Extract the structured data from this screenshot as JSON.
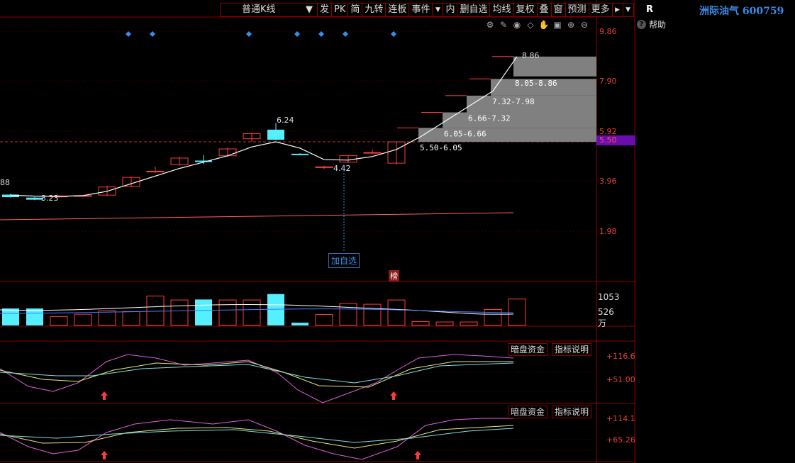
{
  "toolbar": {
    "kline_type": "普通K线",
    "items": [
      "发",
      "PK",
      "简",
      "九转",
      "连板",
      "事件",
      "内",
      "删自选",
      "均线",
      "复权",
      "叠",
      "窗",
      "预测",
      "更多"
    ]
  },
  "right_panel": {
    "label": "R",
    "stock_name": "洲际油气 600759",
    "help": "帮助"
  },
  "price_axis": {
    "ticks": [
      "9.86",
      "7.90",
      "5.92",
      "3.96",
      "1.98"
    ],
    "current": "5.50"
  },
  "volume_axis": {
    "ticks": [
      "1053",
      "526"
    ],
    "unit": "万"
  },
  "ind1": {
    "ticks": [
      "+116.6",
      "+51.00"
    ],
    "btn1": "暗盘资金",
    "btn2": "指标说明"
  },
  "ind2": {
    "ticks": [
      "+114.1",
      "+65.26"
    ],
    "btn1": "暗盘资金",
    "btn2": "指标说明"
  },
  "add_watch": "加自选",
  "bang": "榜",
  "chart_data": {
    "type": "candlestick",
    "ylim": [
      0.8,
      10.6
    ],
    "candles": [
      {
        "o": 3.42,
        "h": 3.46,
        "l": 3.3,
        "c": 3.32,
        "up": false
      },
      {
        "o": 3.3,
        "h": 3.32,
        "l": 3.2,
        "c": 3.22,
        "up": false
      },
      {
        "o": 3.33,
        "h": 3.4,
        "l": 3.3,
        "c": 3.36,
        "up": true
      },
      {
        "o": 3.36,
        "h": 3.4,
        "l": 3.34,
        "c": 3.38,
        "up": true
      },
      {
        "o": 3.4,
        "h": 3.78,
        "l": 3.36,
        "c": 3.72,
        "up": true
      },
      {
        "o": 3.75,
        "h": 4.12,
        "l": 3.72,
        "c": 4.1,
        "up": true
      },
      {
        "o": 4.32,
        "h": 4.52,
        "l": 4.28,
        "c": 4.34,
        "up": true
      },
      {
        "o": 4.6,
        "h": 4.92,
        "l": 4.56,
        "c": 4.86,
        "up": true
      },
      {
        "o": 4.72,
        "h": 4.98,
        "l": 4.62,
        "c": 4.76,
        "up": false
      },
      {
        "o": 4.95,
        "h": 5.28,
        "l": 4.9,
        "c": 5.22,
        "up": true
      },
      {
        "o": 5.62,
        "h": 5.85,
        "l": 5.5,
        "c": 5.82,
        "up": true
      },
      {
        "o": 5.58,
        "h": 6.24,
        "l": 5.56,
        "c": 5.98,
        "up": false
      },
      {
        "o": 5.02,
        "h": 5.05,
        "l": 5.0,
        "c": 5.03,
        "up": false
      },
      {
        "o": 4.52,
        "h": 4.56,
        "l": 4.42,
        "c": 4.48,
        "up": true
      },
      {
        "o": 4.7,
        "h": 4.98,
        "l": 4.66,
        "c": 4.96,
        "up": true
      },
      {
        "o": 5.06,
        "h": 5.2,
        "l": 5.0,
        "c": 5.08,
        "up": true
      },
      {
        "o": 4.66,
        "h": 5.5,
        "l": 4.6,
        "c": 5.5,
        "up": true
      }
    ],
    "ma": [
      3.4,
      3.36,
      3.35,
      3.38,
      3.55,
      3.85,
      4.15,
      4.45,
      4.7,
      4.95,
      5.3,
      5.5,
      5.25,
      4.8,
      4.78,
      4.92,
      5.2,
      5.7,
      6.3,
      6.9,
      7.5,
      8.86
    ],
    "limit_steps": [
      {
        "from": 5.5,
        "to": 6.05,
        "label": "5.50-6.05"
      },
      {
        "from": 6.05,
        "to": 6.66,
        "label": "6.05-6.66"
      },
      {
        "from": 6.66,
        "to": 7.32,
        "label": "6.66-7.32"
      },
      {
        "from": 7.32,
        "to": 7.98,
        "label": "7.32-7.98"
      },
      {
        "from": 8.05,
        "to": 8.86,
        "label": "8.05-8.86"
      }
    ],
    "annotations": [
      {
        "text": "6.24"
      },
      {
        "text": "4.42"
      },
      {
        "text": "3.23"
      },
      {
        "text": "8.86"
      },
      {
        "text": "88"
      }
    ],
    "volume": {
      "values": [
        680,
        680,
        360,
        450,
        590,
        560,
        1180,
        1020,
        1040,
        1020,
        1020,
        1260,
        110,
        440,
        880,
        850,
        1020,
        160,
        140,
        140,
        640,
        1060
      ],
      "up": [
        false,
        false,
        true,
        true,
        true,
        true,
        true,
        true,
        false,
        true,
        true,
        false,
        false,
        true,
        true,
        true,
        true,
        true,
        true,
        true,
        true,
        true
      ],
      "ylim": [
        0,
        1250
      ]
    }
  }
}
